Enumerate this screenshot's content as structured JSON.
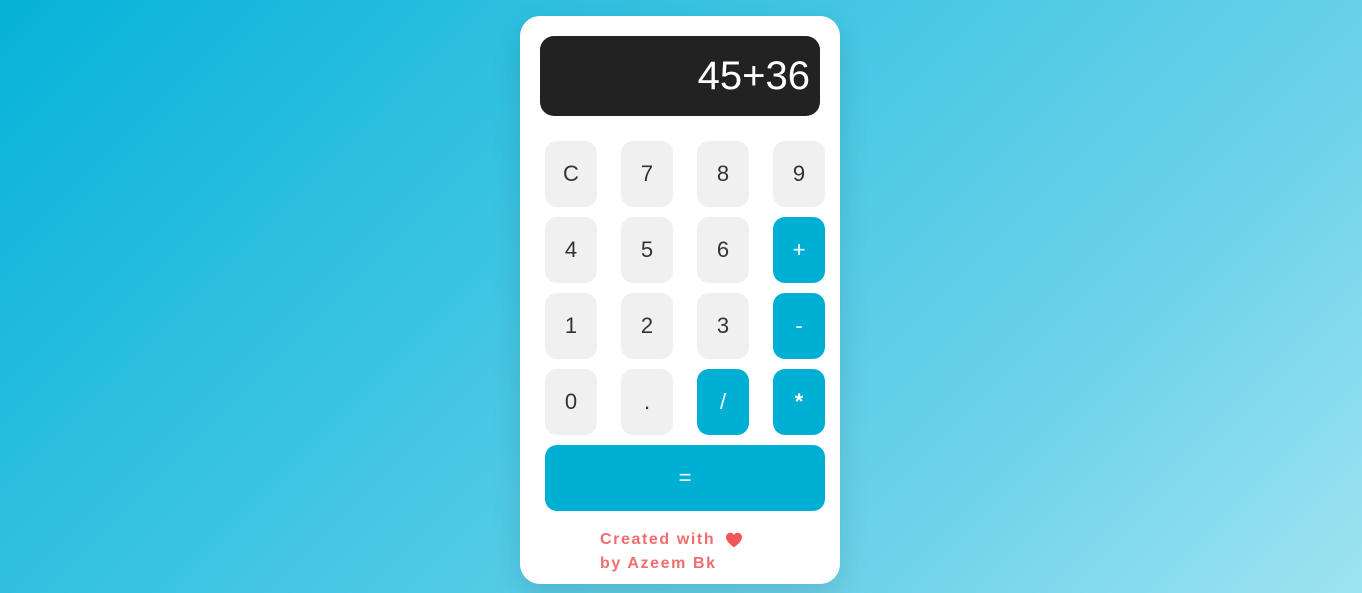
{
  "display": {
    "value": "45+36"
  },
  "keys": [
    {
      "label": "C"
    },
    {
      "label": "7"
    },
    {
      "label": "8"
    },
    {
      "label": "9"
    },
    {
      "label": "4"
    },
    {
      "label": "5"
    },
    {
      "label": "6"
    },
    {
      "label": "+"
    },
    {
      "label": "1"
    },
    {
      "label": "2"
    },
    {
      "label": "3"
    },
    {
      "label": "-"
    },
    {
      "label": "0"
    },
    {
      "label": "."
    },
    {
      "label": "/"
    },
    {
      "label": "*"
    }
  ],
  "equals": {
    "label": "="
  },
  "footer": {
    "line1": "Created with",
    "line2": "by Azeem Bk",
    "heart_icon": "heart-icon"
  },
  "colors": {
    "accent": "#00b0d4",
    "display_bg": "#222222",
    "key_bg": "#f0f0f0",
    "credit_text": "#f26d6d",
    "heart": "#f0575b"
  }
}
